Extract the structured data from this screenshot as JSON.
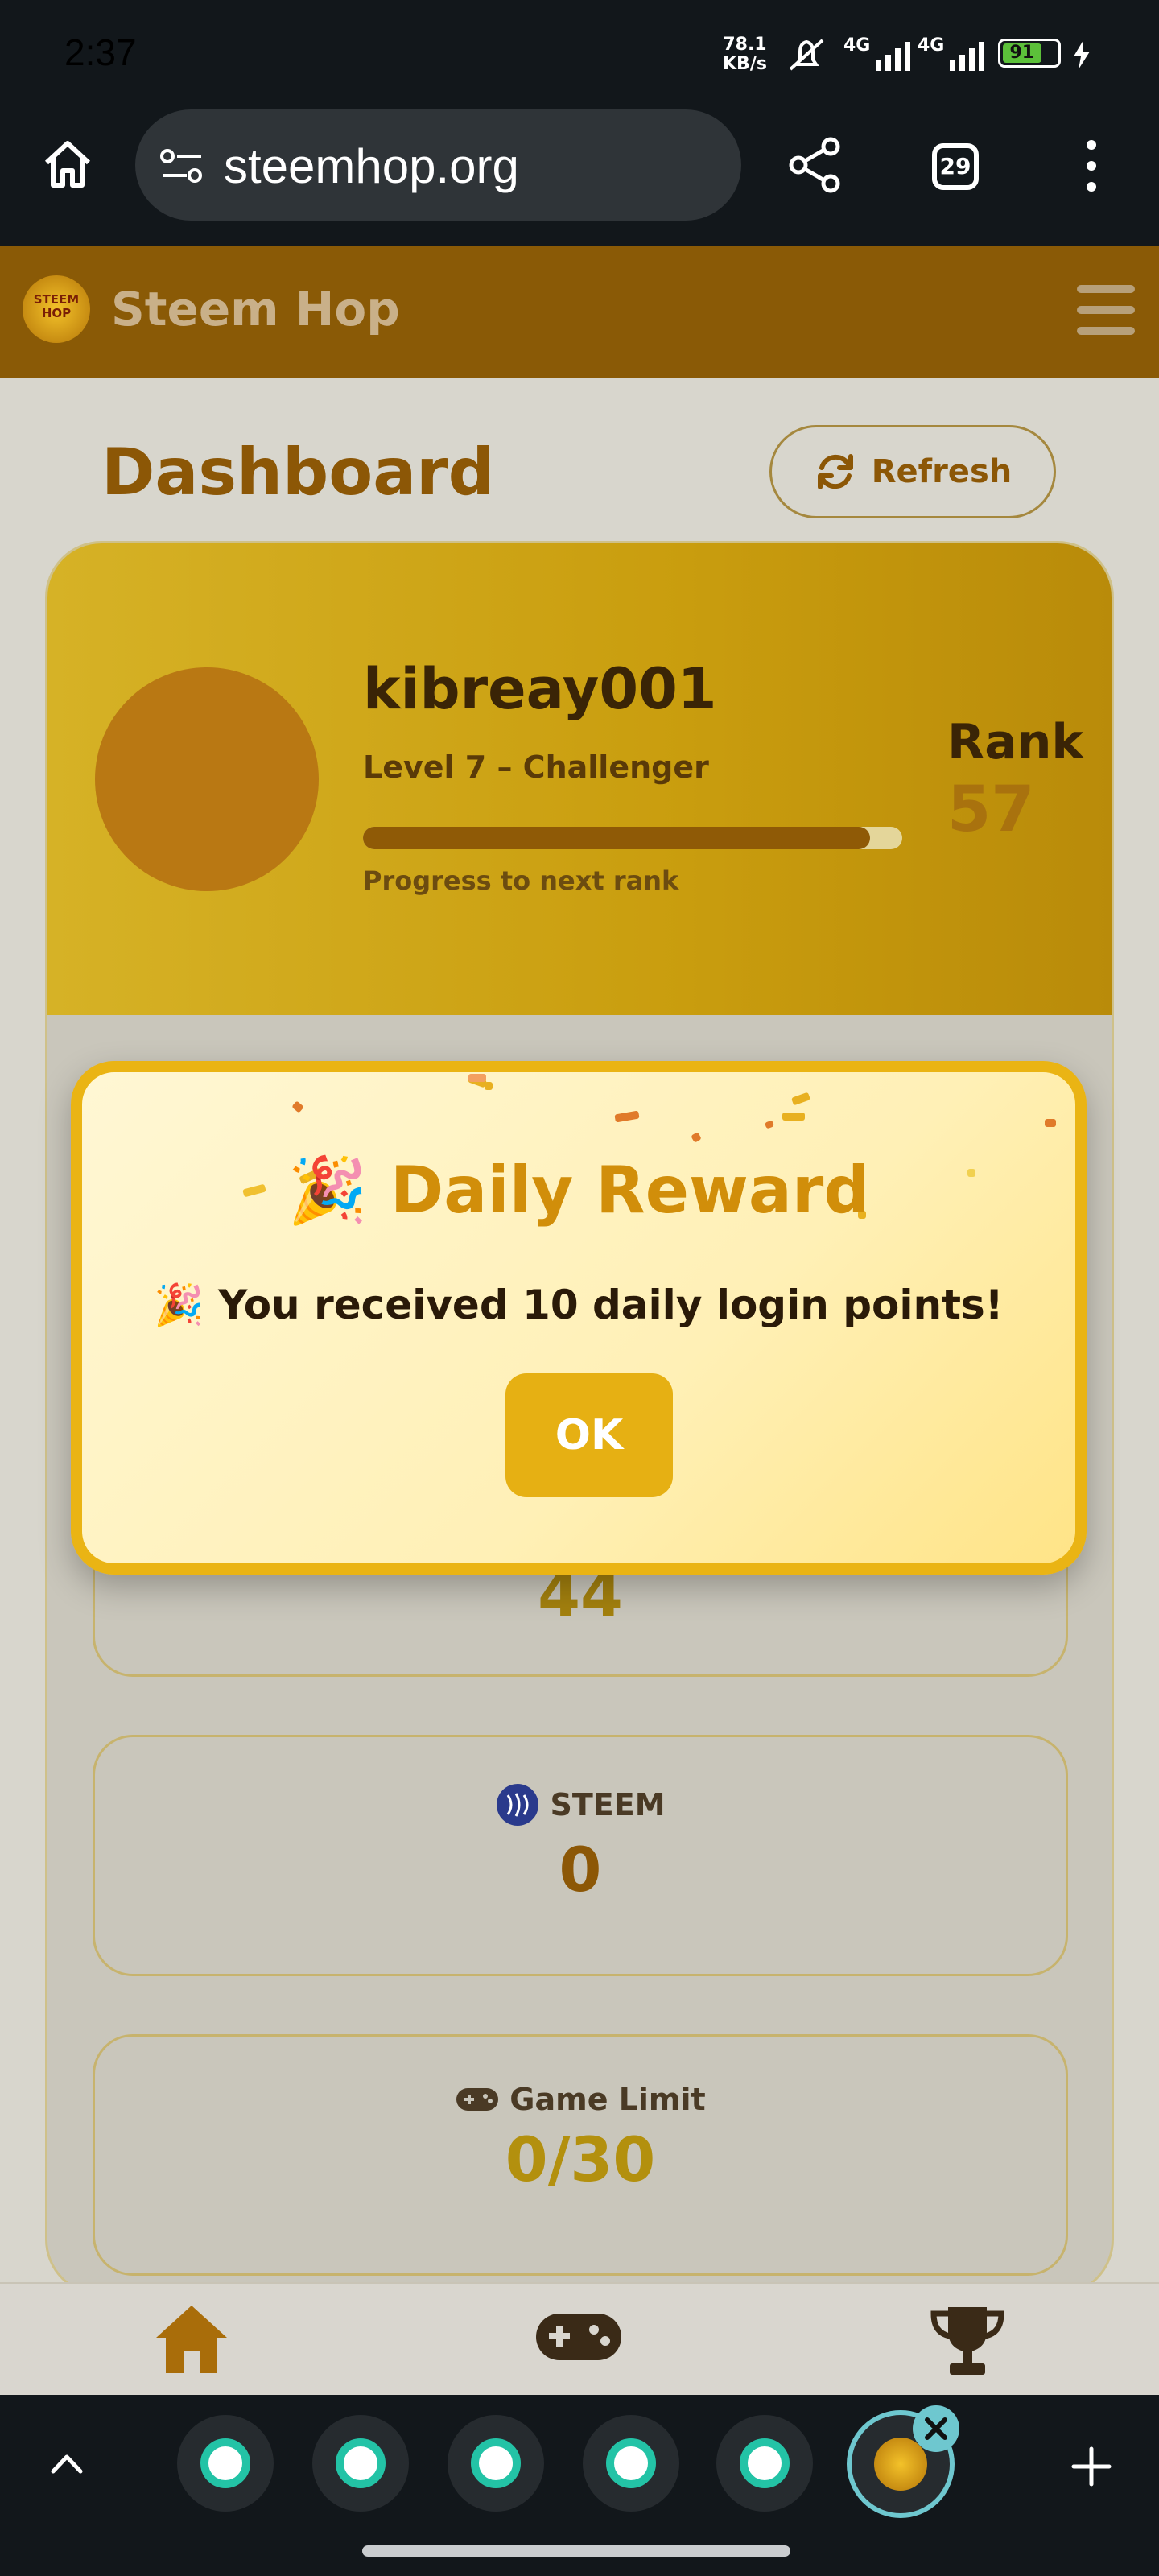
{
  "status_bar": {
    "time": "2:37",
    "net_speed_value": "78.1",
    "net_speed_unit": "KB/s",
    "network_1": "4G",
    "network_2": "4G",
    "battery": "91"
  },
  "browser": {
    "url": "steemhop.org",
    "tab_count": "29"
  },
  "site": {
    "brand": "Steem Hop",
    "logo_text": "STEEM HOP"
  },
  "dashboard": {
    "title": "Dashboard",
    "refresh_label": "Refresh",
    "username": "kibreay001",
    "level": "Level 7 – Challenger",
    "progress_label": "Progress to next rank",
    "progress_fraction": 0.94,
    "rank_label": "Rank",
    "rank_value": "57"
  },
  "stats": [
    {
      "label": "",
      "value": "44"
    },
    {
      "label": "STEEM",
      "value": "0"
    },
    {
      "label": "Game Limit",
      "value": "0/30"
    }
  ],
  "modal": {
    "title": "Daily Reward",
    "message": "You received 10 daily login points!",
    "ok_label": "OK"
  },
  "colors": {
    "accent": "#e6b013",
    "brand_dark": "#8a5a06",
    "text_dark": "#3a2406"
  }
}
